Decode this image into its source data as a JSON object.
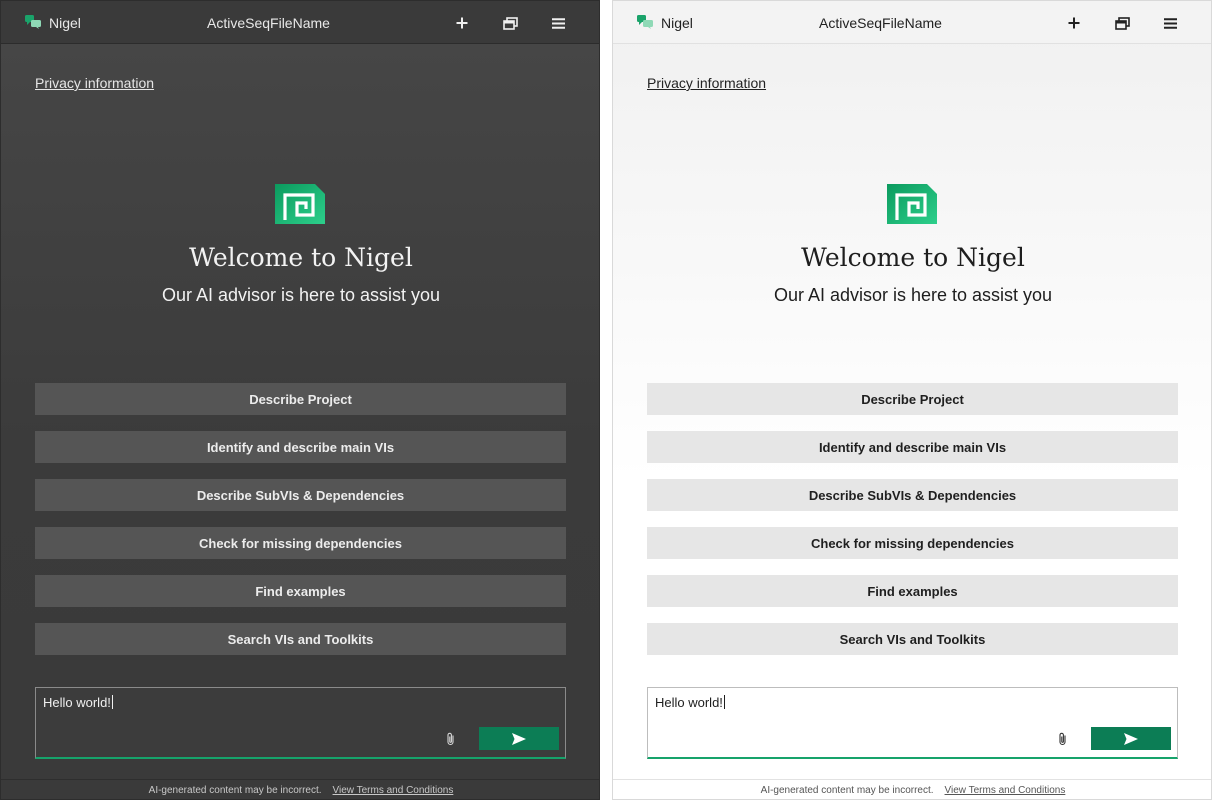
{
  "header": {
    "app_name": "Nigel",
    "file_name": "ActiveSeqFileName",
    "icons": [
      "plus-icon",
      "window-stack-icon",
      "hamburger-menu-icon"
    ]
  },
  "privacy_link": "Privacy information",
  "welcome": {
    "title": "Welcome to Nigel",
    "subtitle": "Our AI advisor is here to assist you"
  },
  "suggestions": [
    "Describe Project",
    "Identify and describe main VIs",
    "Describe SubVIs & Dependencies",
    "Check for missing dependencies",
    "Find examples",
    "Search VIs and Toolkits"
  ],
  "input": {
    "value": "Hello world!"
  },
  "footer": {
    "disclaimer": "AI-generated content may be incorrect.",
    "terms_link": "View Terms and Conditions"
  },
  "colors": {
    "accent_green": "#1aa36a",
    "send_button": "#0c7d55",
    "dark_background": "#3d3d3d",
    "light_background": "#f7f7f7"
  }
}
